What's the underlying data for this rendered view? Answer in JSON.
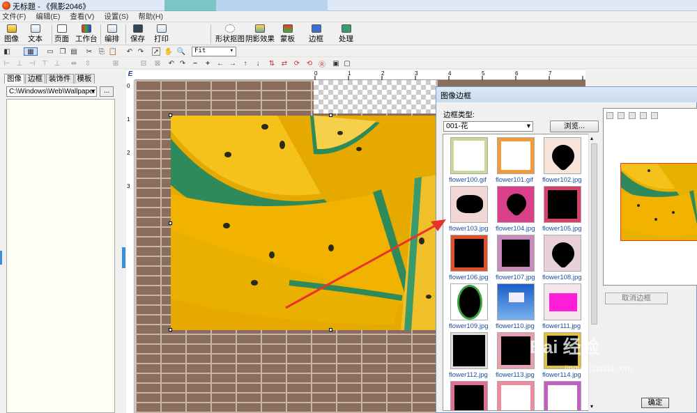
{
  "window": {
    "title": "无标题 - 《佩影2046》"
  },
  "menu": [
    "文件(F)",
    "编辑(E)",
    "查看(V)",
    "设置(S)",
    "帮助(H)"
  ],
  "toolbar": {
    "image": "图像",
    "text": "文本",
    "page": "页面",
    "workbench": "工作台",
    "arrange": "编排",
    "save": "保存",
    "print": "打印",
    "shape_crop": "形状抠图",
    "shadow": "阴影效果",
    "mask": "蒙板",
    "border": "边框",
    "process": "处理"
  },
  "zoom": {
    "value": "Fit"
  },
  "left_panel": {
    "tabs": [
      "图像",
      "边框",
      "装饰件",
      "模板"
    ],
    "path": "C:\\Windows\\Web\\Wallpaper",
    "browse_button": "..."
  },
  "rulers": {
    "corner": "E",
    "h_numbers": [
      "0",
      "1",
      "2",
      "3",
      "4",
      "5",
      "6",
      "7"
    ],
    "v_numbers": [
      "0",
      "1",
      "2",
      "3"
    ]
  },
  "dialog": {
    "title": "图像边框",
    "border_type_label": "边框类型:",
    "border_type_value": "001-花",
    "browse_button": "浏览...",
    "cancel_border_button": "取消边框",
    "ok_button": "确定",
    "thumbnails": [
      "flower100.gif",
      "flower101.gif",
      "flower102.jpg",
      "flower103.jpg",
      "flower104.jpg",
      "flower105.jpg",
      "flower106.jpg",
      "flower107.jpg",
      "flower108.jpg",
      "flower109.jpg",
      "flower110.jpg",
      "flower111.jpg",
      "flower112.jpg",
      "flower113.jpg",
      "flower114.jpg",
      "",
      "",
      ""
    ]
  },
  "watermark": {
    "brand": "Bai 经验",
    "url": "jingyan.baidu.com"
  },
  "colors": {
    "arrow": "#e8322a",
    "accent": "#3a8fd9",
    "link": "#1a4fa0"
  }
}
